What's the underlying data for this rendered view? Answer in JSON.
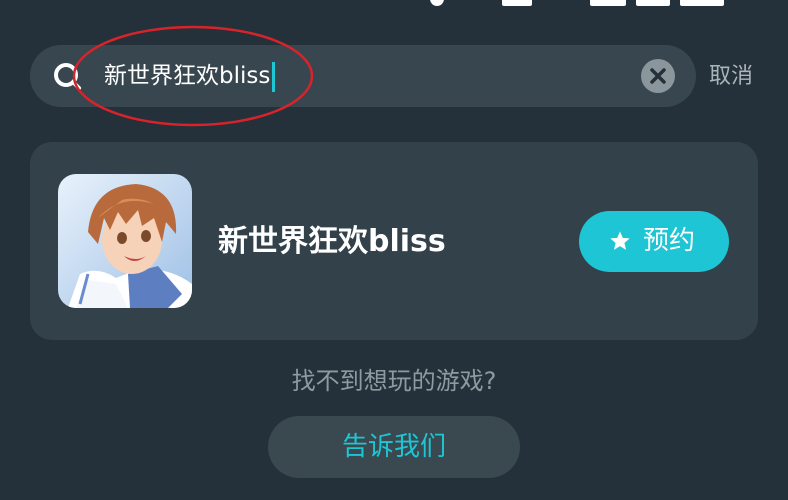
{
  "search": {
    "query": "新世界狂欢bliss",
    "cancel_label": "取消",
    "search_icon": "search-icon",
    "clear_icon": "clear-icon"
  },
  "result": {
    "game_title": "新世界狂欢bliss",
    "reserve_label": "预约",
    "reserve_icon": "star-icon",
    "game_icon": "game-cover-anime-character"
  },
  "footer": {
    "hint": "找不到想玩的游戏?",
    "tell_us_label": "告诉我们"
  },
  "colors": {
    "background": "#25313a",
    "card": "#33414a",
    "accent": "#1ec5d4",
    "annotation": "#d9232a"
  }
}
